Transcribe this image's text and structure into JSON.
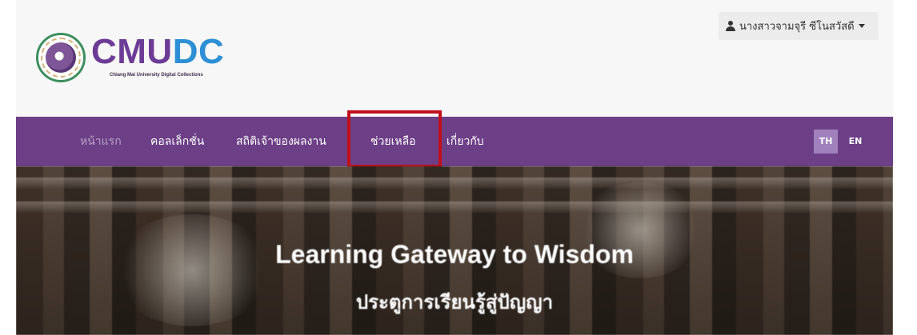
{
  "header": {
    "logo_text_part1": "CMU",
    "logo_text_part2": "DC",
    "logo_subtitle": "Chiang Mai University Digital Collections",
    "user_name": "นางสาวจามจุรี ซีโนสวัสดี"
  },
  "nav": {
    "items": [
      {
        "label": "หน้าแรก"
      },
      {
        "label": "คอลเล็กชั่น"
      },
      {
        "label": "สถิติเจ้าของผลงาน"
      },
      {
        "label": "ช่วยเหลือ"
      },
      {
        "label": "เกี่ยวกับ"
      }
    ],
    "lang_th": "TH",
    "lang_en": "EN"
  },
  "hero": {
    "title": "Learning Gateway to Wisdom",
    "subtitle": "ประตูการเรียนรู้สู่ปัญญา"
  },
  "colors": {
    "nav_bg": "#6c3f86",
    "brand_purple": "#6c3b96",
    "brand_blue": "#2d8fd5",
    "highlight": "#c0101c",
    "lang_active": "#a081bd"
  },
  "icons": [
    "user-icon",
    "caret-down-icon",
    "university-seal-icon"
  ]
}
